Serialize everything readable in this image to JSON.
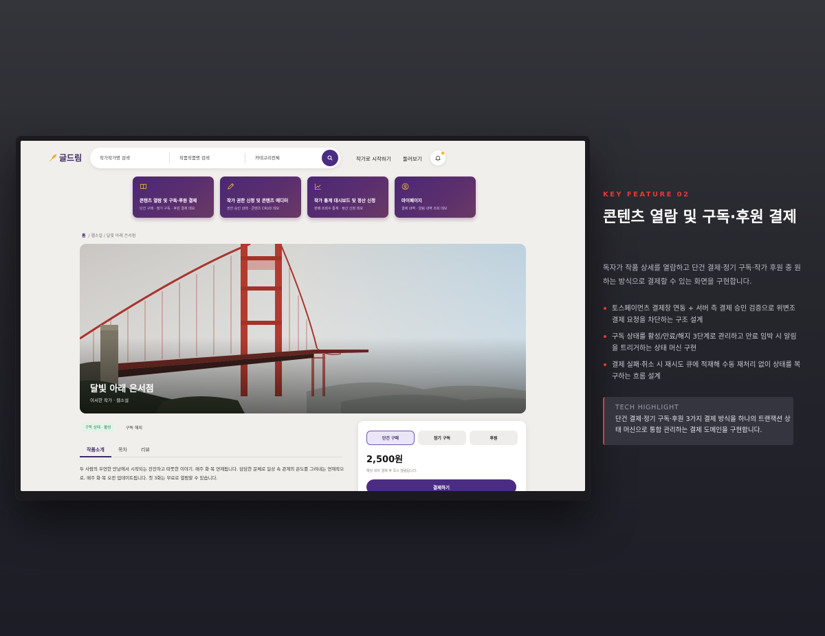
{
  "header": {
    "logo_text": "글드림",
    "search": {
      "author_label": "작가",
      "author_value": "작가명 검색",
      "work_label": "작품",
      "work_value": "작품명 검색",
      "category_label": "카테고리",
      "category_value": "전체"
    },
    "start_as_author": "작가로 시작하기",
    "browse": "둘러보기"
  },
  "feature_cards": [
    {
      "title": "콘텐츠 열람 및 구독·후원 결제",
      "subtitle": "단건 구매 · 정기 구독 · 후원 결제 데모",
      "icon": "book-icon"
    },
    {
      "title": "작가 권한 신청 및 콘텐츠 에디터",
      "subtitle": "권한 승인 상태 · 콘텐츠 CRUD 데모",
      "icon": "pen-icon"
    },
    {
      "title": "작가 통계 대시보드 및 정산 신청",
      "subtitle": "판매·조회수 통계 · 정산 신청 데모",
      "icon": "chart-icon"
    },
    {
      "title": "마이페이지",
      "subtitle": "결제 내역 · 알림 내역 조회 데모",
      "icon": "user-icon"
    }
  ],
  "breadcrumb": {
    "home": "홈",
    "path": "/ 웹소설 / 달빛 아래 은서점"
  },
  "hero": {
    "title": "달빛 아래 은서점",
    "subtitle": "이서한 작가 · 웹소설"
  },
  "subscription": {
    "status": "구독 상태 · 활성",
    "cancel": "구독 해지"
  },
  "tabs": [
    "작품소개",
    "목차",
    "리뷰"
  ],
  "description": "두 사람의 우연한 만남에서 시작되는 잔잔하고 따뜻한 이야기. 매주 화·목 연재됩니다. 담담한 문체로 일상 속 관계의 온도를 그려내는 연재작으로, 매주 화·목 오전 업데이트됩니다. 첫 3화는 무료로 열람할 수 있습니다.",
  "purchase": {
    "options": [
      "단건 구매",
      "정기 구독",
      "후원"
    ],
    "selected": "단건 구매",
    "price": "2,500원",
    "note": "해당 회차 결제 후 즉시 열람됩니다.",
    "pay_button": "결제하기"
  },
  "feature": {
    "eyebrow": "KEY FEATURE 02",
    "title": "콘텐츠 열람 및 구독·후원 결제",
    "lead": "독자가 작품 상세를 열람하고 단건 결제·정기 구독·작가 후원 중 원하는 방식으로 결제할 수 있는 화면을 구현합니다.",
    "bullets": [
      "토스페이먼츠 결제창 연동 + 서버 측 결제 승인 검증으로 위변조 결제 요청을 차단하는 구조 설계",
      "구독 상태를 활성/만료/해지 3단계로 관리하고 만료 임박 시 알림을 트리거하는 상태 머신 구현",
      "결제 실패·취소 시 재시도 큐에 적재해 수동 재처리 없이 상태를 복구하는 흐름 설계"
    ],
    "tech_title": "TECH HIGHLIGHT",
    "tech_body": "단건 결제·정기 구독·후원 3가지 결제 방식을 하나의 트랜잭션 상태 머신으로 통합 관리하는 결제 도메인을 구현합니다."
  },
  "colors": {
    "accent": "#e03a3a",
    "brand": "#4a2c83",
    "card": "#4b2873"
  }
}
